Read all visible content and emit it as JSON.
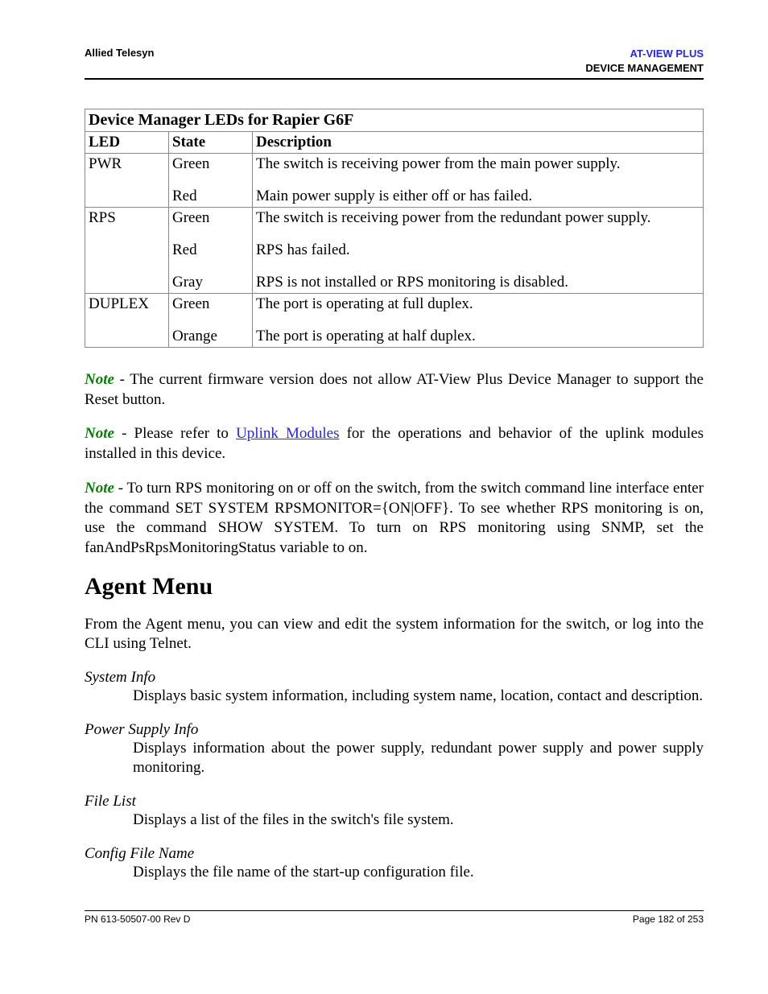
{
  "header": {
    "left": "Allied Telesyn",
    "right_line1": "AT-VIEW PLUS",
    "right_line2": "DEVICE MANAGEMENT"
  },
  "table": {
    "title": "Device Manager LEDs for Rapier G6F",
    "headers": {
      "led": "LED",
      "state": "State",
      "desc": "Description"
    },
    "rows": [
      {
        "led": "PWR",
        "states": [
          "Green",
          "Red"
        ],
        "descs": [
          "The switch is receiving power from the main power supply.",
          "Main power supply is either off or has failed."
        ]
      },
      {
        "led": "RPS",
        "states": [
          "Green",
          "Red",
          "Gray"
        ],
        "descs": [
          "The switch is receiving power from the redundant power supply.",
          "RPS has failed.",
          "RPS is not installed or RPS monitoring is disabled."
        ]
      },
      {
        "led": "DUPLEX",
        "states": [
          "Green",
          "Orange"
        ],
        "descs": [
          "The port is operating at full duplex.",
          "The port is operating at half duplex."
        ]
      }
    ]
  },
  "notes": {
    "label": "Note",
    "n1": " - The current firmware version does not allow AT-View Plus Device Manager to support the Reset button.",
    "n2a": " - Please refer to ",
    "n2_link": "Uplink Modules",
    "n2b": " for the operations and behavior of the uplink modules installed in this device.",
    "n3": " - To turn RPS monitoring on or off on the switch, from the switch command line interface enter the command SET SYSTEM RPSMONITOR={ON|OFF}. To see whether RPS monitoring is on, use the command SHOW SYSTEM. To turn on RPS monitoring using SNMP, set the fanAndPsRpsMonitoringStatus variable to on."
  },
  "section": {
    "title": "Agent Menu",
    "intro": "From the Agent menu, you can view and edit the system information for the switch, or log into the CLI using Telnet.",
    "items": [
      {
        "term": "System Info",
        "def": "Displays basic system information, including system name, location, contact and description."
      },
      {
        "term": "Power Supply Info",
        "def": "Displays information about the power supply, redundant power supply and power supply monitoring."
      },
      {
        "term": "File List",
        "def": "Displays a list of the files in the switch's file system."
      },
      {
        "term": "Config File Name",
        "def": "Displays the file name of the start-up configuration file."
      }
    ]
  },
  "footer": {
    "left": "PN 613-50507-00 Rev D",
    "right": "Page 182 of 253"
  }
}
